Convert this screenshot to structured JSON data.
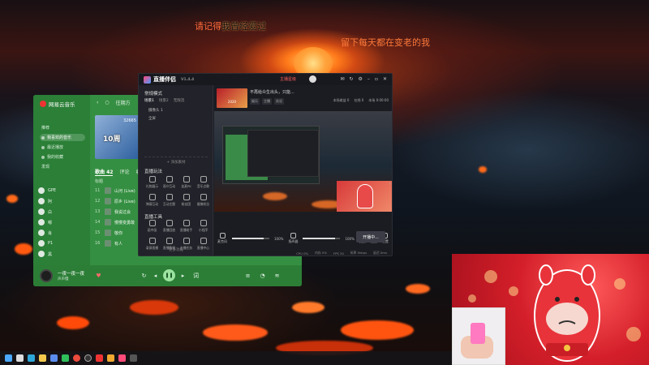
{
  "lyrics": {
    "line1_pre": "请记得",
    "line1_highlight": "我曾经",
    "line1_post": "爱过",
    "line2": "留下每天都在变老的我"
  },
  "music_app": {
    "brand": "网易云音乐",
    "sidebar": [
      "推荐",
      "我喜欢的音乐",
      "最近播放",
      "我的收藏",
      "发现"
    ],
    "sidebar_active": 1,
    "nav_label": "往期方",
    "album_text": "10周",
    "album_playcount": "32665",
    "tabs": [
      "歌曲 42",
      "评论",
      "收藏"
    ],
    "active_tab": 0,
    "list_header": "标题",
    "songs": [
      {
        "num": "11",
        "title": "山河 (Live)"
      },
      {
        "num": "12",
        "title": "原乡 (Live)"
      },
      {
        "num": "13",
        "title": "我说过会"
      },
      {
        "num": "14",
        "title": "慢慢变勇敢"
      },
      {
        "num": "15",
        "title": "敬你"
      },
      {
        "num": "16",
        "title": "有人"
      }
    ],
    "people": [
      "GPE",
      "阿",
      "白",
      "嗯",
      "肖",
      "P1",
      "黑",
      "有鲸"
    ],
    "now_playing_title": "一夜一夜一夜",
    "now_playing_sub": "声声慢"
  },
  "live_app": {
    "title": "直播伴侣",
    "version": "V1.4.4",
    "rec_label": "主播星级",
    "scene_header": "常规模式",
    "scene_tabs": [
      "场景1",
      "场景2",
      "无限流"
    ],
    "scene_items": [
      "摄像头 1",
      "全屏"
    ],
    "add_source": "+ 添加素材",
    "tools_header_1": "直播玩法",
    "tools_1": [
      "礼物展示",
      "观众互动",
      "连麦PK",
      "音乐点歌",
      "弹幕互动",
      "互动主题",
      "粉丝团",
      "摄像机位"
    ],
    "tools_header_2": "直播工具",
    "tools_2": [
      "画中画",
      "直播回放",
      "直播助手",
      "小程序",
      "录屏直播",
      "直播数据",
      "主播任务",
      "直播中心"
    ],
    "more_tools": "更多功能",
    "stream_title": "不再给众生出头，只能...",
    "stream_tags": [
      "娱乐",
      "主播",
      "实况"
    ],
    "stream_meta": [
      "本场收益 0",
      "在线 0",
      "本场 0:00:00"
    ],
    "pip_tag": "2020",
    "mixer": [
      {
        "label": "麦克风",
        "value": "100%"
      },
      {
        "label": "扬声器",
        "value": "100%"
      }
    ],
    "mixer_level_fraction": 0.85,
    "mix_tools": [
      "美颜",
      "滤镜",
      "设置"
    ],
    "start_button": "开播中...",
    "status": [
      "CPU 0%",
      "内存 0%",
      "FPS 30",
      "码率 0kbps",
      "延迟 0ms"
    ]
  },
  "colors": {
    "music_green": "#2f8a3c",
    "live_bg": "#1d1e24",
    "lyric": "#ff6a3a",
    "cam_red": "#d41f2a"
  },
  "taskbar_icons": [
    "windows-icon",
    "search-icon",
    "edge-icon",
    "files-icon",
    "store-icon",
    "wechat-icon",
    "chrome-icon",
    "obs-icon",
    "music-icon",
    "folder-icon",
    "live-icon",
    "terminal-icon"
  ]
}
